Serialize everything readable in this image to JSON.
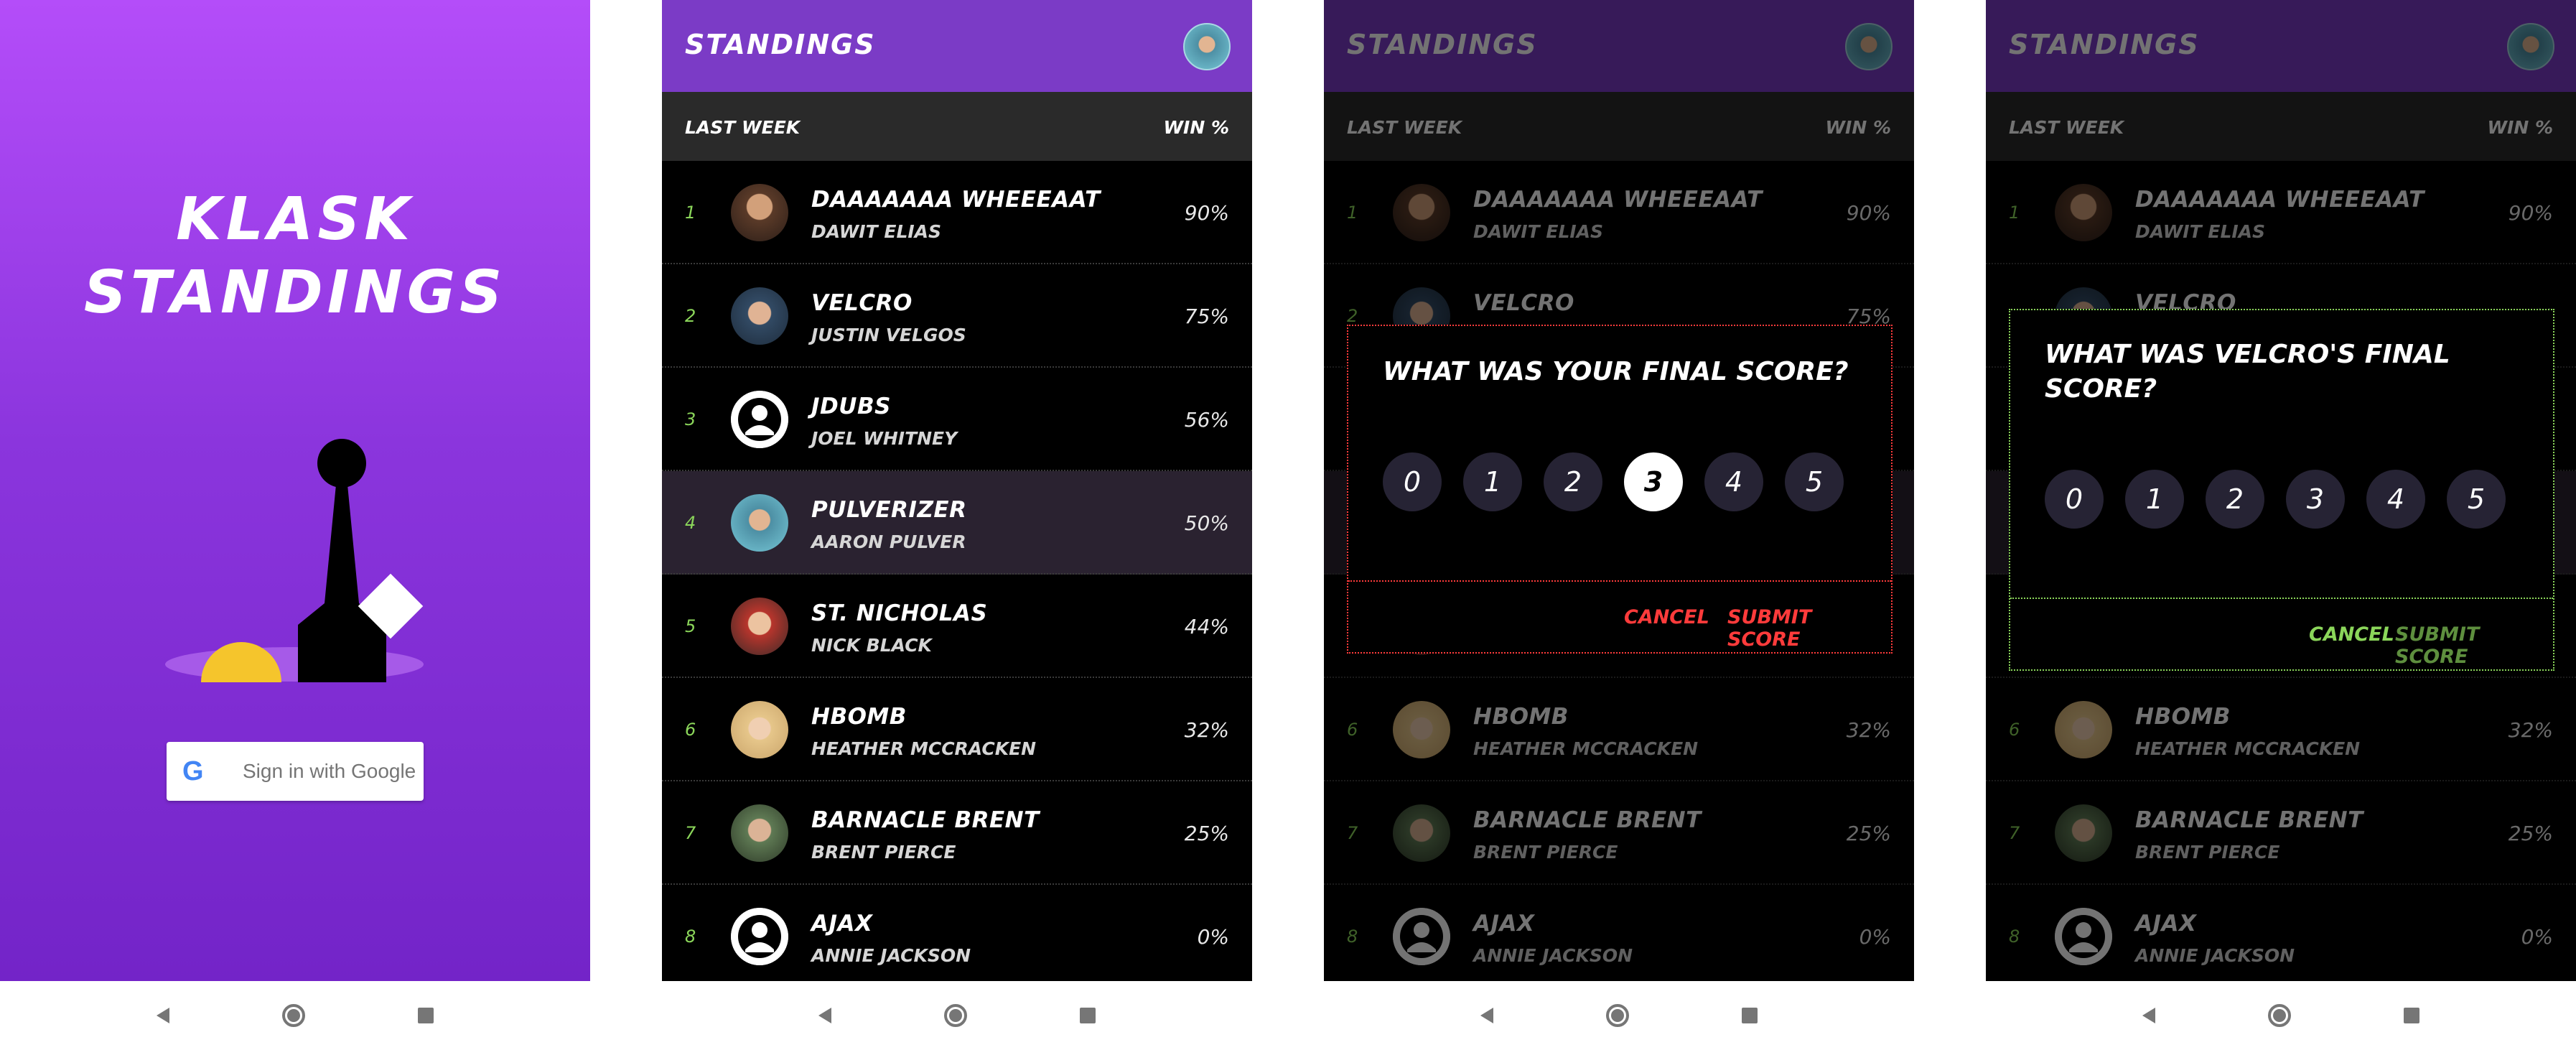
{
  "login": {
    "title_line1": "KLASK",
    "title_line2": "STANDINGS",
    "google_logo": "G",
    "signin_label": "Sign in with Google"
  },
  "standings": {
    "title": "STANDINGS",
    "period": "LAST WEEK",
    "win_label": "WIN %",
    "rows": [
      {
        "rank": "1",
        "nick": "DAAAAAAA WHEEEAAT",
        "name": "DAWIT ELIAS",
        "pct": "90%",
        "avatar": "av-brown"
      },
      {
        "rank": "2",
        "nick": "VELCRO",
        "name": "JUSTIN VELGOS",
        "pct": "75%",
        "avatar": "av-blue"
      },
      {
        "rank": "3",
        "nick": "JDUBS",
        "name": "JOEL WHITNEY",
        "pct": "56%",
        "avatar": "av-default"
      },
      {
        "rank": "4",
        "nick": "PULVERIZER",
        "name": "AARON PULVER",
        "pct": "50%",
        "avatar": "av-teal"
      },
      {
        "rank": "5",
        "nick": "ST. NICHOLAS",
        "name": "NICK BLACK",
        "pct": "44%",
        "avatar": "av-red"
      },
      {
        "rank": "6",
        "nick": "HBOMB",
        "name": "HEATHER MCCRACKEN",
        "pct": "32%",
        "avatar": "av-blonde"
      },
      {
        "rank": "7",
        "nick": "BARNACLE BRENT",
        "name": "BRENT PIERCE",
        "pct": "25%",
        "avatar": "av-green"
      },
      {
        "rank": "8",
        "nick": "AJAX",
        "name": "ANNIE JACKSON",
        "pct": "0%",
        "avatar": "av-default"
      }
    ]
  },
  "dialog_own": {
    "question": "WHAT WAS YOUR FINAL SCORE?",
    "scores": [
      "0",
      "1",
      "2",
      "3",
      "4",
      "5"
    ],
    "selected": "3",
    "cancel": "CANCEL",
    "submit": "SUBMIT SCORE",
    "action_color": "#ff3b3b"
  },
  "dialog_opp": {
    "question_line1": "WHAT WAS VELCRO'S FINAL",
    "question_line2": "SCORE?",
    "scores": [
      "0",
      "1",
      "2",
      "3",
      "4",
      "5"
    ],
    "cancel": "CANCEL",
    "submit": "SUBMIT SCORE",
    "action_color": "#8bd65a"
  },
  "colors": {
    "brand_purple": "#7b3bc6",
    "rank_green": "#8bd65a",
    "highlight_row": "#2a2230",
    "meeple_yellow": "#f5c52c"
  }
}
